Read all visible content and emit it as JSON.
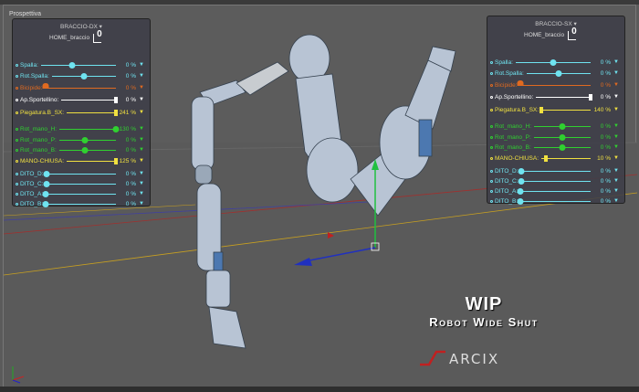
{
  "viewport": {
    "label": "Prospettiva"
  },
  "overlay": {
    "title": "WIP",
    "subtitle": "Robot Wide Shut",
    "logo_text": "SARCIX"
  },
  "colors": {
    "cyan": "#6fe3f0",
    "orange": "#e06a20",
    "white": "#ffffff",
    "yellow": "#f0e040",
    "green": "#30d030",
    "panel": "#3e3e48",
    "background": "#5c5c5c"
  },
  "panels": [
    {
      "title": "BRACCIO-DX ▾",
      "home_label": "HOME_braccio",
      "home_value": "0",
      "rows": [
        {
          "label": "Spalla:",
          "value": "0 %",
          "fill": 0.42,
          "color": "cyan",
          "knob": "circle"
        },
        {
          "label": "Rot.Spalla:",
          "value": "0 %",
          "fill": 0.5,
          "color": "cyan",
          "knob": "circle"
        },
        {
          "label": "Bicipide:",
          "value": "0 %",
          "fill": 0.0,
          "color": "orange",
          "knob": "tri"
        },
        {
          "label": "Ap.Sportellino:",
          "value": "0 %",
          "fill": 1.0,
          "color": "white",
          "knob": "sq"
        },
        {
          "label": "Piegatura.B_SX:",
          "value": "241 %",
          "fill": 1.0,
          "color": "yellow",
          "knob": "sq"
        },
        {
          "label": "Rot_mano_H:",
          "value": "130 %",
          "fill": 1.0,
          "color": "green",
          "knob": "circle"
        },
        {
          "label": "Rot_mano_P:",
          "value": "0 %",
          "fill": 0.45,
          "color": "green",
          "knob": "circle"
        },
        {
          "label": "Rot_mano_B:",
          "value": "0 %",
          "fill": 0.45,
          "color": "green",
          "knob": "circle"
        },
        {
          "label": "MANO-CHIUSA:",
          "value": "125 %",
          "fill": 1.0,
          "color": "yellow",
          "knob": "sq"
        },
        {
          "label": "DITO_D:",
          "value": "0 %",
          "fill": 0.0,
          "color": "cyan",
          "knob": "circle"
        },
        {
          "label": "DITO_C:",
          "value": "0 %",
          "fill": 0.0,
          "color": "cyan",
          "knob": "circle"
        },
        {
          "label": "DITO_A:",
          "value": "0 %",
          "fill": 0.0,
          "color": "cyan",
          "knob": "circle"
        },
        {
          "label": "DITO_B:",
          "value": "0 %",
          "fill": 0.0,
          "color": "cyan",
          "knob": "circle"
        }
      ]
    },
    {
      "title": "BRACCIO-SX ▾",
      "home_label": "HOME_braccio",
      "home_value": "0",
      "rows": [
        {
          "label": "Spalla:",
          "value": "0 %",
          "fill": 0.5,
          "color": "cyan",
          "knob": "circle"
        },
        {
          "label": "Rot.Spalla:",
          "value": "0 %",
          "fill": 0.5,
          "color": "cyan",
          "knob": "circle"
        },
        {
          "label": "Bicipide:",
          "value": "0 %",
          "fill": 0.0,
          "color": "orange",
          "knob": "tri"
        },
        {
          "label": "Ap.Sportellino:",
          "value": "0 %",
          "fill": 1.0,
          "color": "white",
          "knob": "sq"
        },
        {
          "label": "Piegatura.B_SX:",
          "value": "140 %",
          "fill": 0.0,
          "color": "yellow",
          "knob": "sq"
        },
        {
          "label": "Rot_mano_H:",
          "value": "0 %",
          "fill": 0.5,
          "color": "green",
          "knob": "circle"
        },
        {
          "label": "Rot_mano_P:",
          "value": "0 %",
          "fill": 0.5,
          "color": "green",
          "knob": "circle"
        },
        {
          "label": "Rot_mano_B:",
          "value": "0 %",
          "fill": 0.5,
          "color": "green",
          "knob": "circle"
        },
        {
          "label": "MANO-CHIUSA:",
          "value": "10 %",
          "fill": 0.1,
          "color": "yellow",
          "knob": "sq"
        },
        {
          "label": "DITO_D:",
          "value": "0 %",
          "fill": 0.0,
          "color": "cyan",
          "knob": "circle"
        },
        {
          "label": "DITO_C:",
          "value": "0 %",
          "fill": 0.0,
          "color": "cyan",
          "knob": "circle"
        },
        {
          "label": "DITO_A:",
          "value": "0 %",
          "fill": 0.0,
          "color": "cyan",
          "knob": "circle"
        },
        {
          "label": "DITO_B:",
          "value": "0 %",
          "fill": 0.0,
          "color": "cyan",
          "knob": "circle"
        }
      ]
    }
  ]
}
